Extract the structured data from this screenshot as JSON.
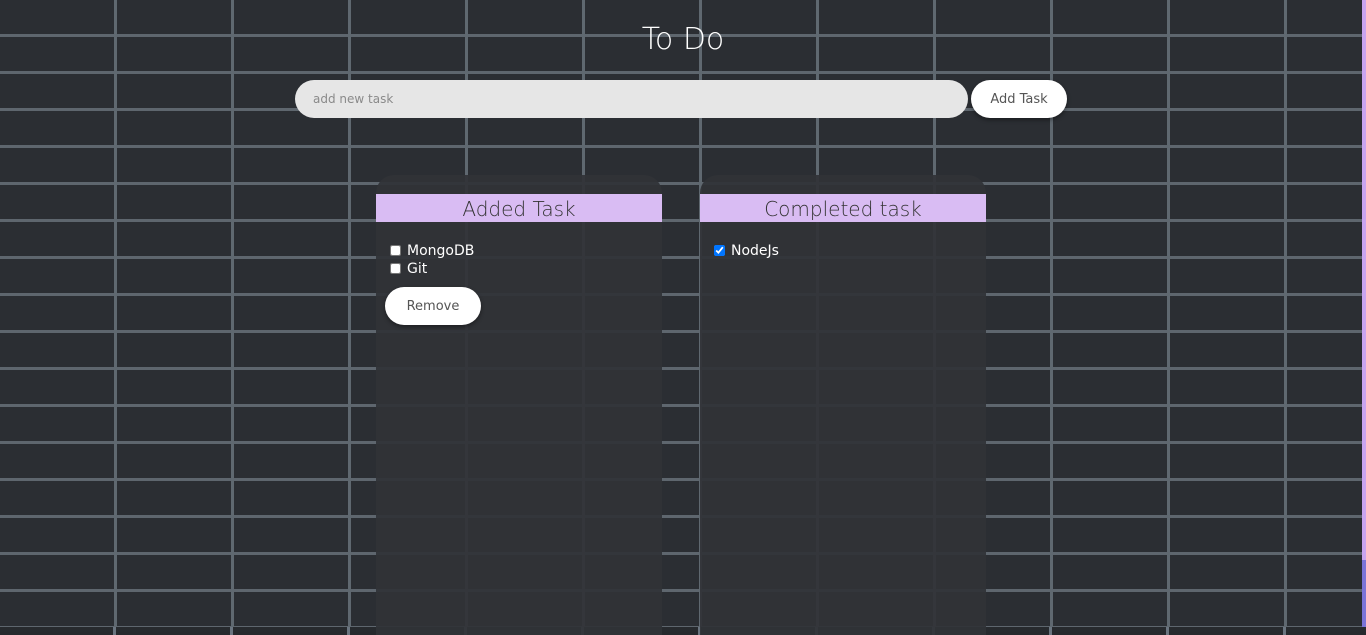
{
  "title": "To Do",
  "new_task": {
    "placeholder": "add new task",
    "value": "",
    "add_label": "Add Task"
  },
  "added": {
    "heading": "Added Task",
    "items": [
      {
        "label": "MongoDB",
        "checked": false
      },
      {
        "label": "Git",
        "checked": false
      }
    ],
    "remove_label": "Remove"
  },
  "completed": {
    "heading": "Completed task",
    "items": [
      {
        "label": "NodeJs",
        "checked": true
      }
    ]
  },
  "colors": {
    "header_bg": "#d9bcf3",
    "panel_bg": "#303337"
  }
}
